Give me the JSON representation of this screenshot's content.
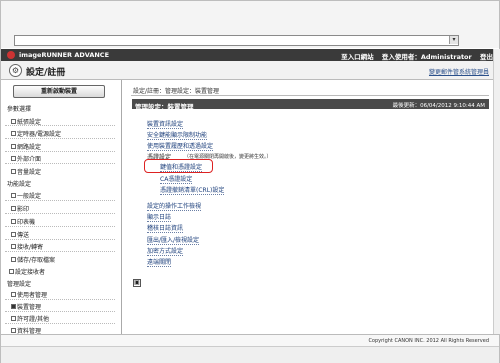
{
  "browser": {
    "dropdown_icon": "chevron-down-icon",
    "dropdown_glyph": "▾"
  },
  "header": {
    "brand": "imageRUNNER ADVANCE",
    "links": [
      "至入口網站",
      "登入使用者：Administrator",
      "登出"
    ]
  },
  "subheader": {
    "title": "設定/註冊",
    "right_link": "變更郵件管系統管理員"
  },
  "sidebar": {
    "refresh_button": "重新啟動裝置",
    "groups": [
      {
        "label": "參數選擇",
        "items": [
          "紙張設定",
          "定時器/電源設定",
          "網路設定",
          "外部介面",
          "音量設定"
        ]
      },
      {
        "label": "功能設定",
        "items": [
          "一般設定",
          "影印",
          "印表機",
          "傳送",
          "接收/轉寄",
          "儲存/存取檔案"
        ]
      },
      {
        "label": "設定接收者",
        "items": []
      },
      {
        "label": "管理設定",
        "items": [
          "使用者管理",
          "裝置管理",
          "許可證/其他",
          "資料管理"
        ]
      }
    ],
    "active_item": "裝置管理"
  },
  "main": {
    "breadcrumb": "設定/註冊：管理設定：裝置管理",
    "section_title": "管理設定：裝置管理",
    "last_update": "最後更新：06/04/2012 9:10:44 AM",
    "links": {
      "device_info": "裝置資訊設定",
      "security_func": "安全鍵能顯示限制功能",
      "usage_log": "使用裝置履歷和透過設定",
      "certificate": "憑證設定",
      "cert_note": "（在電源關閉再開啟後，變更將生效。）",
      "key_cert": "鍵值和憑證設定",
      "ca_cert": "CA憑證設定",
      "crl": "憑證撤銷清單(CRL)設定",
      "remote_ops": "設定的操作工作檢視",
      "show_log": "顯示日誌",
      "audit_log": "稽核日誌資訊",
      "import_export": "匯出/匯入/檢視設定",
      "additional_func": "加密方式設定",
      "remote_ui_access": "遠端關閉"
    },
    "collapse_icon": "collapse-icon",
    "collapse_glyph": "▣"
  },
  "footer": {
    "copyright": "Copyright CANON INC. 2012 All Rights Reserved"
  },
  "colors": {
    "accent": "#3a3a3a",
    "highlight": "#dd2222",
    "link": "#1a3d7a"
  }
}
